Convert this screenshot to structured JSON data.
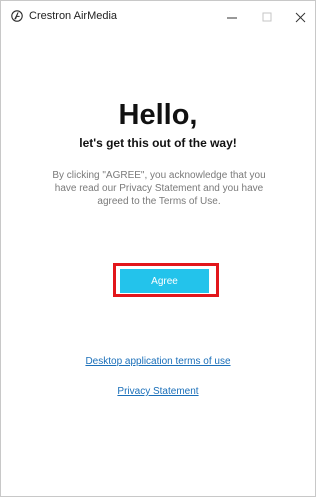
{
  "window": {
    "app_title": "Crestron AirMedia",
    "app_icon": "crestron-logo-icon",
    "controls": {
      "minimize": "—",
      "maximize": "□",
      "close": "✕"
    }
  },
  "main": {
    "heading": "Hello,",
    "subheading": "let's get this out of the way!",
    "disclaimer": "By clicking \"AGREE\", you acknowledge that you have read our Privacy Statement and you have agreed to the Terms of Use.",
    "agree_label": "Agree",
    "terms_link": "Desktop application terms of use",
    "privacy_link": "Privacy Statement"
  },
  "colors": {
    "accent": "#23c3eb",
    "highlight": "#e2161b",
    "link": "#1a6fb9"
  }
}
